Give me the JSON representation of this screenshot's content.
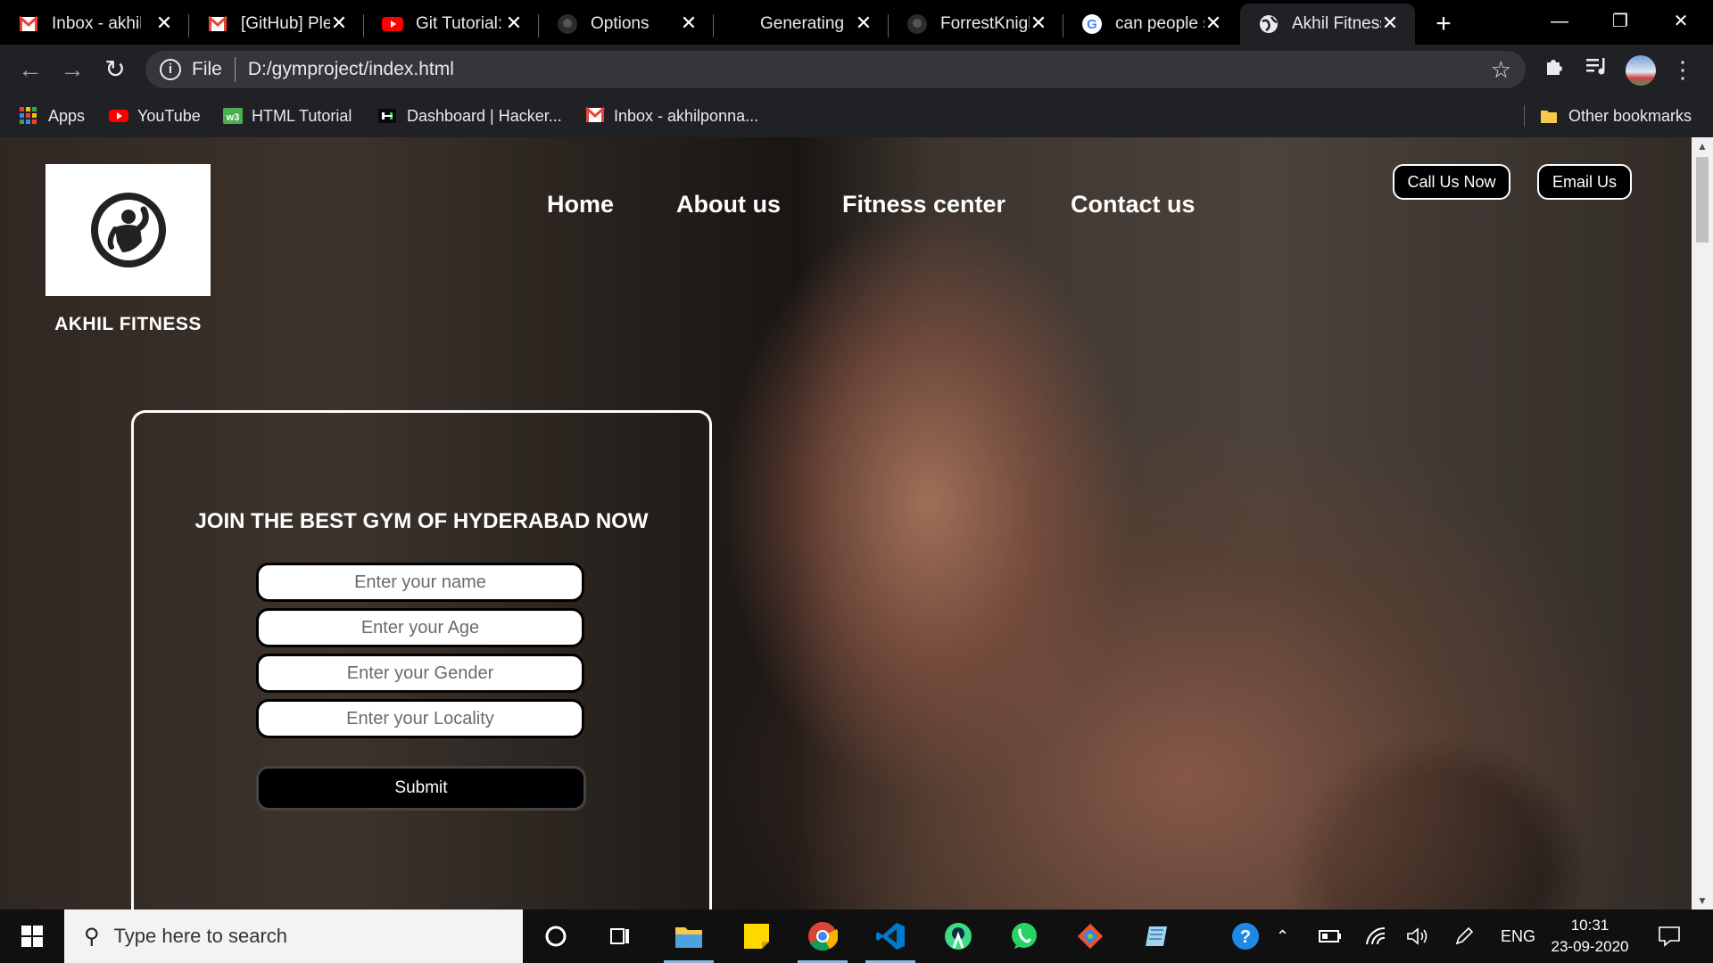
{
  "browser": {
    "tabs": [
      {
        "title": "Inbox - akhil",
        "icon": "gmail-icon"
      },
      {
        "title": "[GitHub] Ple",
        "icon": "gmail-icon"
      },
      {
        "title": "Git Tutorial: ",
        "icon": "youtube-icon"
      },
      {
        "title": "Options",
        "icon": "github-icon"
      },
      {
        "title": "Generating a",
        "icon": "none"
      },
      {
        "title": "ForrestKnigh",
        "icon": "github-icon"
      },
      {
        "title": "can people s",
        "icon": "google-icon"
      },
      {
        "title": "Akhil Fitness",
        "icon": "globe-icon",
        "active": true
      }
    ],
    "url_scheme": "File",
    "url": "D:/gymproject/index.html",
    "bookmarks": [
      {
        "label": "Apps",
        "icon": "apps-grid-icon"
      },
      {
        "label": "YouTube",
        "icon": "youtube-icon"
      },
      {
        "label": "HTML Tutorial",
        "icon": "w3schools-icon"
      },
      {
        "label": "Dashboard | Hacker...",
        "icon": "hackerrank-icon"
      },
      {
        "label": "Inbox - akhilponna...",
        "icon": "gmail-icon"
      }
    ],
    "other_bookmarks": "Other bookmarks"
  },
  "site": {
    "brand": "AKHIL FITNESS",
    "nav": [
      "Home",
      "About us",
      "Fitness center",
      "Contact us"
    ],
    "call_button": "Call Us Now",
    "email_button": "Email Us",
    "form": {
      "title": "JOIN THE BEST GYM OF HYDERABAD NOW",
      "placeholders": [
        "Enter your name",
        "Enter your Age",
        "Enter your Gender",
        "Enter your Locality"
      ],
      "submit": "Submit"
    }
  },
  "taskbar": {
    "search_placeholder": "Type here to search",
    "language": "ENG",
    "time": "10:31",
    "date": "23-09-2020"
  },
  "colors": {
    "gmail_red": "#ea4335",
    "youtube_red": "#ff0000",
    "chrome_dark": "#202124",
    "vscode_blue": "#007acc",
    "whatsapp_green": "#25d366"
  }
}
